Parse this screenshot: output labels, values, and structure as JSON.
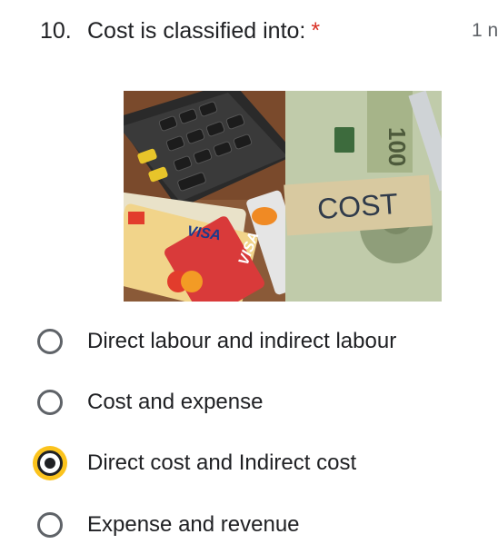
{
  "question": {
    "number": "10.",
    "text": "Cost is classified into:",
    "required_mark": "*",
    "points": "1 n"
  },
  "image": {
    "cost_tag": "COST",
    "card_brand_1": "VISA",
    "card_brand_2": "VISA",
    "bill_value": "100"
  },
  "options": [
    {
      "label": "Direct labour and indirect labour",
      "selected": false
    },
    {
      "label": "Cost and expense",
      "selected": false
    },
    {
      "label": "Direct cost and Indirect cost",
      "selected": true
    },
    {
      "label": "Expense and revenue",
      "selected": false
    }
  ],
  "colors": {
    "required": "#d93025",
    "selected_highlight": "#fbbc04",
    "radio_border": "#5f6368"
  }
}
